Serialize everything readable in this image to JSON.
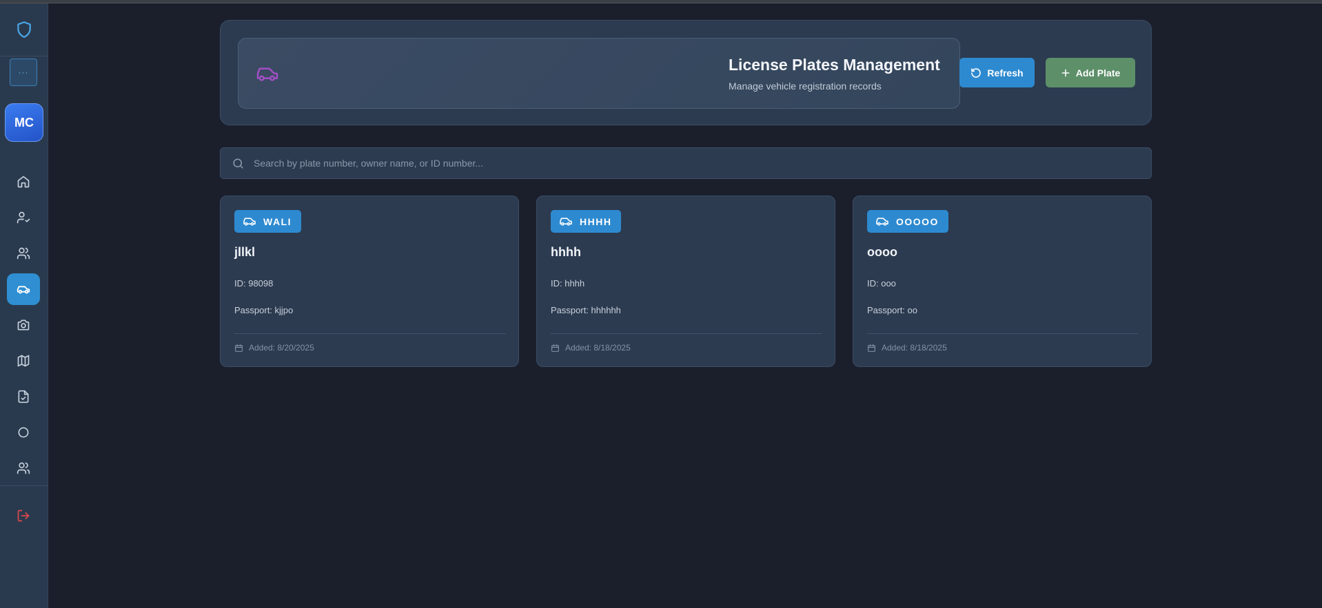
{
  "sidebar": {
    "logo_icon": "shield-icon",
    "more_label": "···",
    "avatar_initials": "MC",
    "nav": [
      {
        "icon": "home-icon"
      },
      {
        "icon": "user-check-icon"
      },
      {
        "icon": "users-icon"
      },
      {
        "icon": "car-icon",
        "active": true
      },
      {
        "icon": "camera-icon"
      },
      {
        "icon": "map-icon"
      },
      {
        "icon": "file-check-icon"
      },
      {
        "icon": "circle-icon"
      },
      {
        "icon": "users-group-icon"
      }
    ],
    "logout_icon": "logout-icon"
  },
  "header": {
    "title": "License Plates Management",
    "subtitle": "Manage vehicle registration records",
    "refresh_label": "Refresh",
    "add_label": "Add Plate"
  },
  "search": {
    "placeholder": "Search by plate number, owner name, or ID number..."
  },
  "cards": [
    {
      "plate": "WALI",
      "owner": "jllkl",
      "id": "ID: 98098",
      "passport": "Passport: kjjpo",
      "added": "Added: 8/20/2025"
    },
    {
      "plate": "HHHH",
      "owner": "hhhh",
      "id": "ID: hhhh",
      "passport": "Passport: hhhhhh",
      "added": "Added: 8/18/2025"
    },
    {
      "plate": "OOOOO",
      "owner": "oooo",
      "id": "ID: ooo",
      "passport": "Passport: oo",
      "added": "Added: 8/18/2025"
    }
  ],
  "colors": {
    "accent_blue": "#2e8ad0",
    "add_green": "#5d8f68",
    "header_car_purple": "#a34fc4",
    "logout_red": "#e0474c"
  }
}
